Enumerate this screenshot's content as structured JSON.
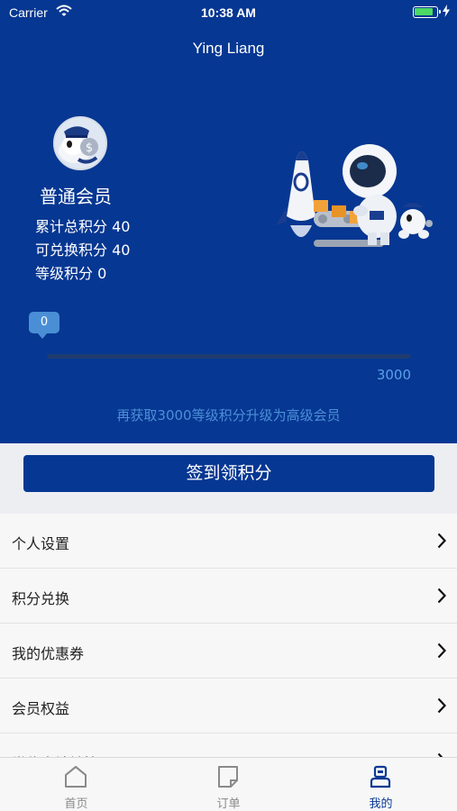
{
  "status_bar": {
    "carrier": "Carrier",
    "time": "10:38 AM",
    "battery_level": 0.85,
    "charging": true
  },
  "nav": {
    "title": "Ying Liang"
  },
  "member": {
    "avatar_icon": "mascot-avatar-icon",
    "level_name": "普通会员",
    "total_points": "累计总积分 40",
    "redeemable_points": "可兑换积分 40",
    "level_points": "等级积分 0"
  },
  "progress": {
    "current_label": "0",
    "max_label": "3000",
    "current": 0,
    "max": 3000,
    "tip": "再获取3000等级积分升级为高级会员"
  },
  "checkin": {
    "label": "签到领积分"
  },
  "menu": {
    "items": [
      {
        "label": "个人设置"
      },
      {
        "label": "积分兑换"
      },
      {
        "label": "我的优惠券"
      },
      {
        "label": "会员权益"
      },
      {
        "label": "常住人地址管理"
      }
    ]
  },
  "tabbar": {
    "tabs": [
      {
        "label": "首页",
        "icon": "home-icon"
      },
      {
        "label": "订单",
        "icon": "order-icon"
      },
      {
        "label": "我的",
        "icon": "profile-icon",
        "active": true
      }
    ]
  },
  "colors": {
    "primary": "#063792",
    "accent": "#4a8fd6",
    "tab_active": "#0a3a94",
    "tab_inactive": "#8a8a8a"
  }
}
